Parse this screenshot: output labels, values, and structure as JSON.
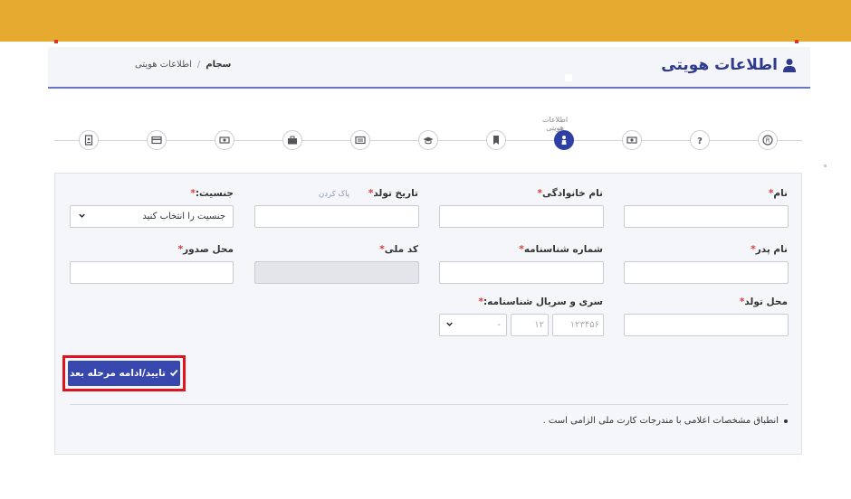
{
  "header": {
    "title": "اطلاعات هویتی",
    "breadcrumb": [
      "سجام",
      "/",
      "اطلاعات هویتی"
    ]
  },
  "stepper": {
    "active_caption": "اطلاعات هویتی",
    "steps": [
      "registration-icon",
      "question-icon",
      "money-icon",
      "identity-icon",
      "bookmark-icon",
      "education-icon",
      "address-icon",
      "job-icon",
      "bank-icon",
      "card-icon",
      "contract-icon"
    ]
  },
  "form": {
    "first_name_label": "نام",
    "last_name_label": "نام خانوادگی",
    "birth_date_label": "تاریخ تولد",
    "clear_label": "پاک کردن",
    "gender_label": "جنسیت:",
    "gender_placeholder": "جنسیت را انتخاب کنید",
    "father_name_label": "نام پدر",
    "id_number_label": "شماره شناسنامه",
    "national_code_label": "کد ملی",
    "issue_place_label": "محل صدور",
    "birth_place_label": "محل تولد",
    "serial_label": "سری و سریال شناسنامه:",
    "serial_number_placeholder": "۱۲۳۴۵۶",
    "serial_digits_placeholder": "۱۲",
    "serial_letter_value": "-",
    "required_mark": "*"
  },
  "submit_label": "تایید/ادامه مرحله بعد",
  "note": "انطباق مشخصات اعلامی با مندرجات کارت ملی الزامی است .",
  "colors": {
    "topbar": "#e7aa30",
    "primary": "#2f3fa3",
    "highlight": "#e0141e"
  }
}
